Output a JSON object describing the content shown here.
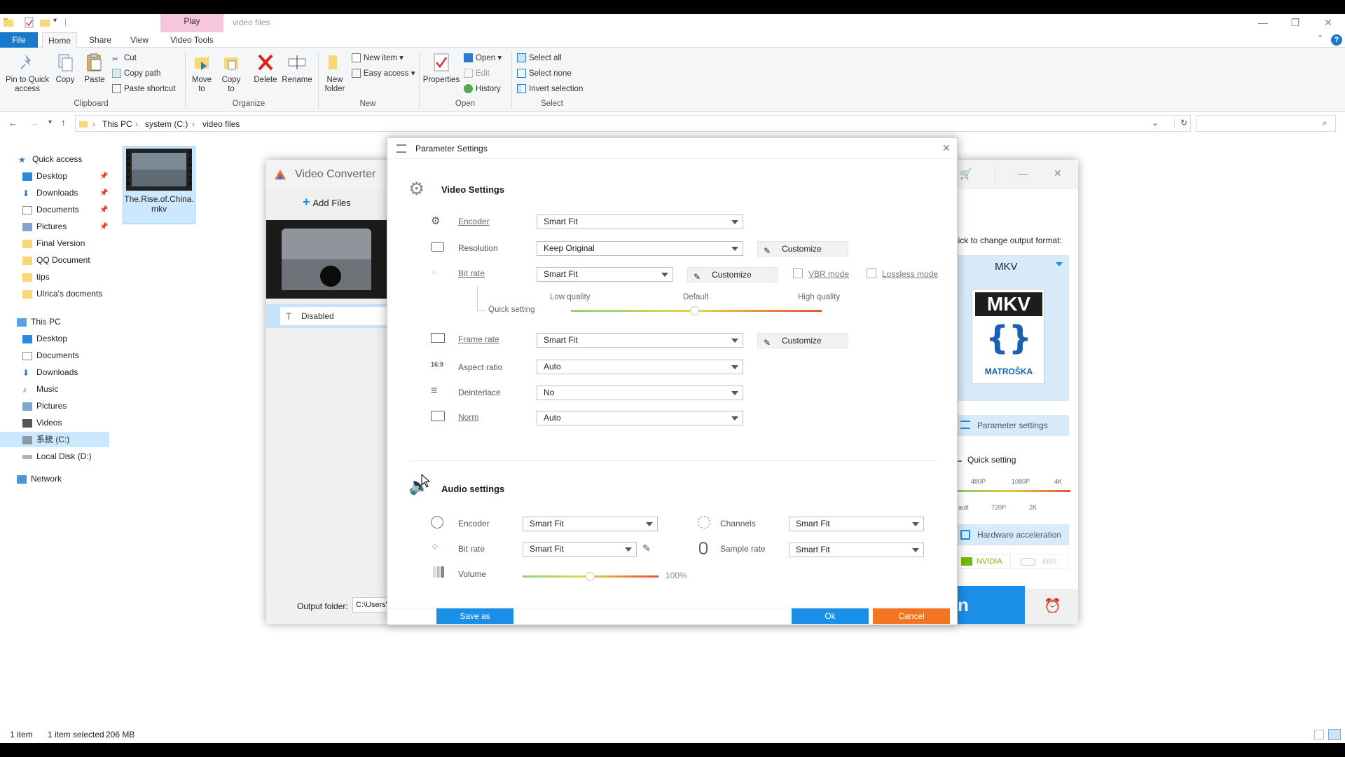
{
  "explorer": {
    "context_tab": "Play",
    "title": "video files",
    "tabs": [
      "File",
      "Home",
      "Share",
      "View",
      "Video Tools"
    ],
    "ribbon": {
      "clipboard": {
        "pin": "Pin to Quick access",
        "copy": "Copy",
        "paste": "Paste",
        "cut": "Cut",
        "copy_path": "Copy path",
        "paste_shortcut": "Paste shortcut",
        "label": "Clipboard"
      },
      "organize": {
        "move_to": "Move to",
        "copy_to": "Copy to",
        "delete": "Delete",
        "rename": "Rename",
        "label": "Organize"
      },
      "new": {
        "new_folder": "New folder",
        "new_item": "New item",
        "easy_access": "Easy access",
        "label": "New"
      },
      "open": {
        "properties": "Properties",
        "open": "Open",
        "edit": "Edit",
        "history": "History",
        "label": "Open"
      },
      "select": {
        "select_all": "Select all",
        "select_none": "Select none",
        "invert": "Invert selection",
        "label": "Select"
      }
    },
    "breadcrumb": [
      "This PC",
      "system (C:)",
      "video files"
    ],
    "nav": {
      "quick_access": "Quick access",
      "quick_items": [
        "Desktop",
        "Downloads",
        "Documents",
        "Pictures",
        "Final Version",
        "QQ Document",
        "tips",
        "Ulrica's docments"
      ],
      "this_pc": "This PC",
      "pc_items": [
        "Desktop",
        "Documents",
        "Downloads",
        "Music",
        "Pictures",
        "Videos",
        "系統 (C:)",
        "Local Disk (D:)"
      ],
      "network": "Network"
    },
    "file": {
      "name": "The.Rise.of.China.mkv"
    },
    "status": {
      "count": "1 item",
      "selected": "1 item selected",
      "size": "206 MB"
    }
  },
  "converter": {
    "title": "Video Converter",
    "add_files": "Add Files",
    "subtitle": "Disabled",
    "output_folder_label": "Output folder:",
    "output_folder_value": "C:\\Users\\",
    "format_hint": "lick to change output format:",
    "format": "MKV",
    "logo_top": "MKV",
    "logo_bottom": "MATROŠKA",
    "param_btn": "Parameter settings",
    "quick_setting": "Quick setting",
    "res_top": [
      "480P",
      "1080P",
      "4K"
    ],
    "res_bottom": [
      "ault",
      "720P",
      "2K"
    ],
    "hw_accel": "Hardware acceleration",
    "nvidia": "NVIDIA",
    "intel": "intel",
    "run_partial": "n"
  },
  "dialog": {
    "title": "Parameter Settings",
    "video": {
      "heading": "Video Settings",
      "encoder": {
        "label": "Encoder",
        "value": "Smart Fit"
      },
      "resolution": {
        "label": "Resolution",
        "value": "Keep Original",
        "button": "Customize"
      },
      "bitrate": {
        "label": "Bit rate",
        "value": "Smart Fit",
        "button": "Customize",
        "vbr": "VBR mode",
        "lossless": "Lossless mode"
      },
      "quality": {
        "low": "Low quality",
        "default": "Default",
        "high": "High quality",
        "quick": "Quick setting",
        "level": 0.5
      },
      "framerate": {
        "label": "Frame rate",
        "value": "Smart Fit",
        "button": "Customize"
      },
      "aspect": {
        "label": "Aspect ratio",
        "value": "Auto"
      },
      "deinterlace": {
        "label": "Deinterlace",
        "value": "No"
      },
      "norm": {
        "label": "Norm",
        "value": "Auto"
      }
    },
    "audio": {
      "heading": "Audio settings",
      "encoder": {
        "label": "Encoder",
        "value": "Smart Fit"
      },
      "bitrate": {
        "label": "Bit rate",
        "value": "Smart Fit"
      },
      "volume": {
        "label": "Volume",
        "value": "100%",
        "level": 0.5
      },
      "channels": {
        "label": "Channels",
        "value": "Smart Fit"
      },
      "samplerate": {
        "label": "Sample rate",
        "value": "Smart Fit"
      }
    },
    "save_as": "Save as",
    "ok": "Ok",
    "cancel": "Cancel"
  },
  "colors": {
    "accent": "#1979ca",
    "ok": "#1a8fe8",
    "cancel": "#f47421",
    "play_tab": "#f5c6dc"
  }
}
